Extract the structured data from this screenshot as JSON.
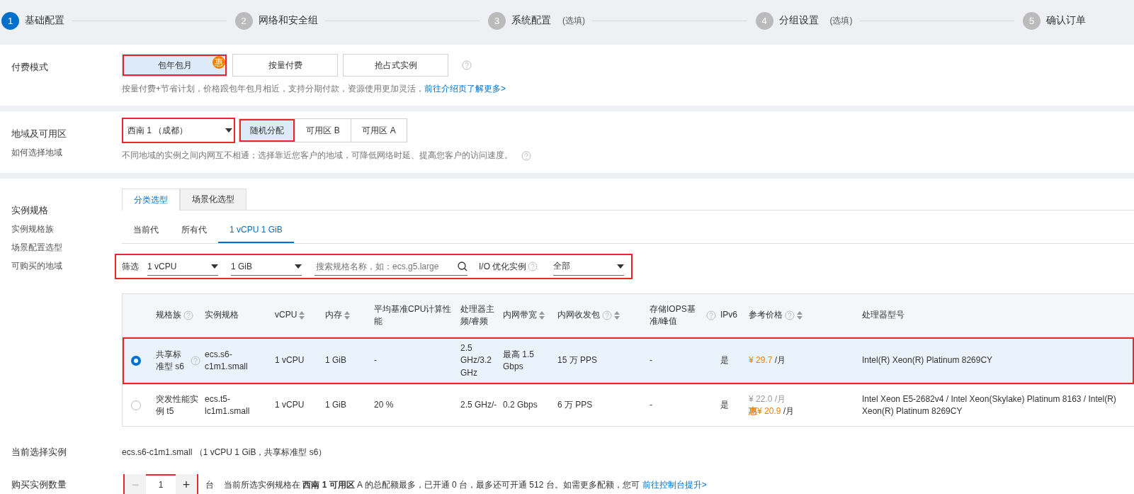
{
  "steps": [
    {
      "number": "1",
      "label": "基础配置",
      "active": true
    },
    {
      "number": "2",
      "label": "网络和安全组",
      "active": false
    },
    {
      "number": "3",
      "label": "系统配置",
      "note": "(选填)",
      "active": false
    },
    {
      "number": "4",
      "label": "分组设置",
      "note": "(选填)",
      "active": false
    },
    {
      "number": "5",
      "label": "确认订单",
      "active": false
    }
  ],
  "billing": {
    "label": "付费模式",
    "options": [
      {
        "label": "包年包月",
        "selected": true,
        "highlighted": true,
        "badge": "惠"
      },
      {
        "label": "按量付费",
        "selected": false,
        "highlighted": false
      },
      {
        "label": "抢占式实例",
        "selected": false,
        "highlighted": false
      }
    ],
    "hint": "按量付费+节省计划，价格跟包年包月相近，支持分期付款，资源使用更加灵活，",
    "link": "前往介绍页了解更多>"
  },
  "region": {
    "label": "地域及可用区",
    "sublabel": "如何选择地域",
    "select": {
      "value": "西南 1 （成都）",
      "highlighted": true
    },
    "zones": [
      {
        "label": "随机分配",
        "selected": true,
        "highlighted": true
      },
      {
        "label": "可用区 B",
        "selected": false,
        "highlighted": false
      },
      {
        "label": "可用区 A",
        "selected": false,
        "highlighted": false
      }
    ],
    "hint": "不同地域的实例之间内网互不相通；选择靠近您客户的地域，可降低网络时延、提高您客户的访问速度。"
  },
  "instance": {
    "label": "实例规格",
    "links": [
      "实例规格族",
      "场景配置选型",
      "可购买的地域"
    ],
    "tabs": [
      {
        "label": "分类选型",
        "selected": true
      },
      {
        "label": "场景化选型",
        "selected": false
      }
    ],
    "subtabs": [
      {
        "label": "当前代",
        "selected": false
      },
      {
        "label": "所有代",
        "selected": false
      },
      {
        "label": "1 vCPU 1 GiB",
        "selected": true
      }
    ],
    "filter": {
      "highlighted": true,
      "label": "筛选",
      "selects": [
        "1 vCPU",
        "1 GiB"
      ],
      "search_placeholder": "搜索规格名称，如：ecs.g5.large",
      "io_label": "I/O 优化实例",
      "io_value": "全部"
    },
    "table": {
      "columns": [
        {
          "label": "规格族",
          "help": true,
          "sortable": false
        },
        {
          "label": "实例规格",
          "help": false,
          "sortable": false
        },
        {
          "label": "vCPU",
          "help": false,
          "sortable": true
        },
        {
          "label": "内存",
          "help": false,
          "sortable": true
        },
        {
          "label": "平均基准CPU计算性能",
          "help": false,
          "sortable": false
        },
        {
          "label": "处理器主频/睿频",
          "help": false,
          "sortable": false
        },
        {
          "label": "内网带宽",
          "help": false,
          "sortable": true
        },
        {
          "label": "内网收发包",
          "help": true,
          "sortable": true
        },
        {
          "label": "存储IOPS基准/峰值",
          "help": true,
          "sortable": false
        },
        {
          "label": "IPv6",
          "help": false,
          "sortable": false
        },
        {
          "label": "参考价格",
          "help": true,
          "sortable": true
        },
        {
          "label": "处理器型号",
          "help": false,
          "sortable": false
        }
      ],
      "rows": [
        {
          "selected": true,
          "highlighted": true,
          "family": "共享标准型 s6",
          "family_help": true,
          "spec": "ecs.s6-c1m1.small",
          "vcpu": "1 vCPU",
          "memory": "1 GiB",
          "baseline": "-",
          "frequency": "2.5 GHz/3.2 GHz",
          "bandwidth": "最高 1.5 Gbps",
          "pps": "15 万 PPS",
          "iops": "-",
          "ipv6": "是",
          "prices": [
            {
              "kind": "current",
              "amount": "¥ 29.7",
              "unit": "/月"
            }
          ],
          "cpu": "Intel(R) Xeon(R) Platinum 8269CY"
        },
        {
          "selected": false,
          "highlighted": false,
          "family": "突发性能实例 t5",
          "family_help": false,
          "spec": "ecs.t5-lc1m1.small",
          "vcpu": "1 vCPU",
          "memory": "1 GiB",
          "baseline": "20 %",
          "frequency": "2.5 GHz/-",
          "bandwidth": "0.2 Gbps",
          "pps": "6 万 PPS",
          "iops": "-",
          "ipv6": "是",
          "prices": [
            {
              "kind": "original",
              "amount": "¥ 22.0",
              "unit": "/月"
            },
            {
              "kind": "current",
              "prefix": "惠",
              "amount": "¥ 20.9",
              "unit": "/月"
            }
          ],
          "cpu": "Intel Xeon E5-2682v4 / Intel Xeon(Skylake) Platinum 8163 / Intel(R) Xeon(R) Platinum 8269CY"
        }
      ]
    }
  },
  "current": {
    "label": "当前选择实例",
    "value": "ecs.s6-c1m1.small （1 vCPU 1 GiB，共享标准型 s6）"
  },
  "quantity": {
    "label": "购买实例数量",
    "decrease": "−",
    "value": "1",
    "increase": "+",
    "highlighted": true,
    "unit": "台",
    "hint": "当前所选实例规格在 **西南 1 可用区** A 的总配额最多，已开通 0 台，最多还可开通 512 台。如需更多配额，您可",
    "link": "前往控制台提升>"
  }
}
